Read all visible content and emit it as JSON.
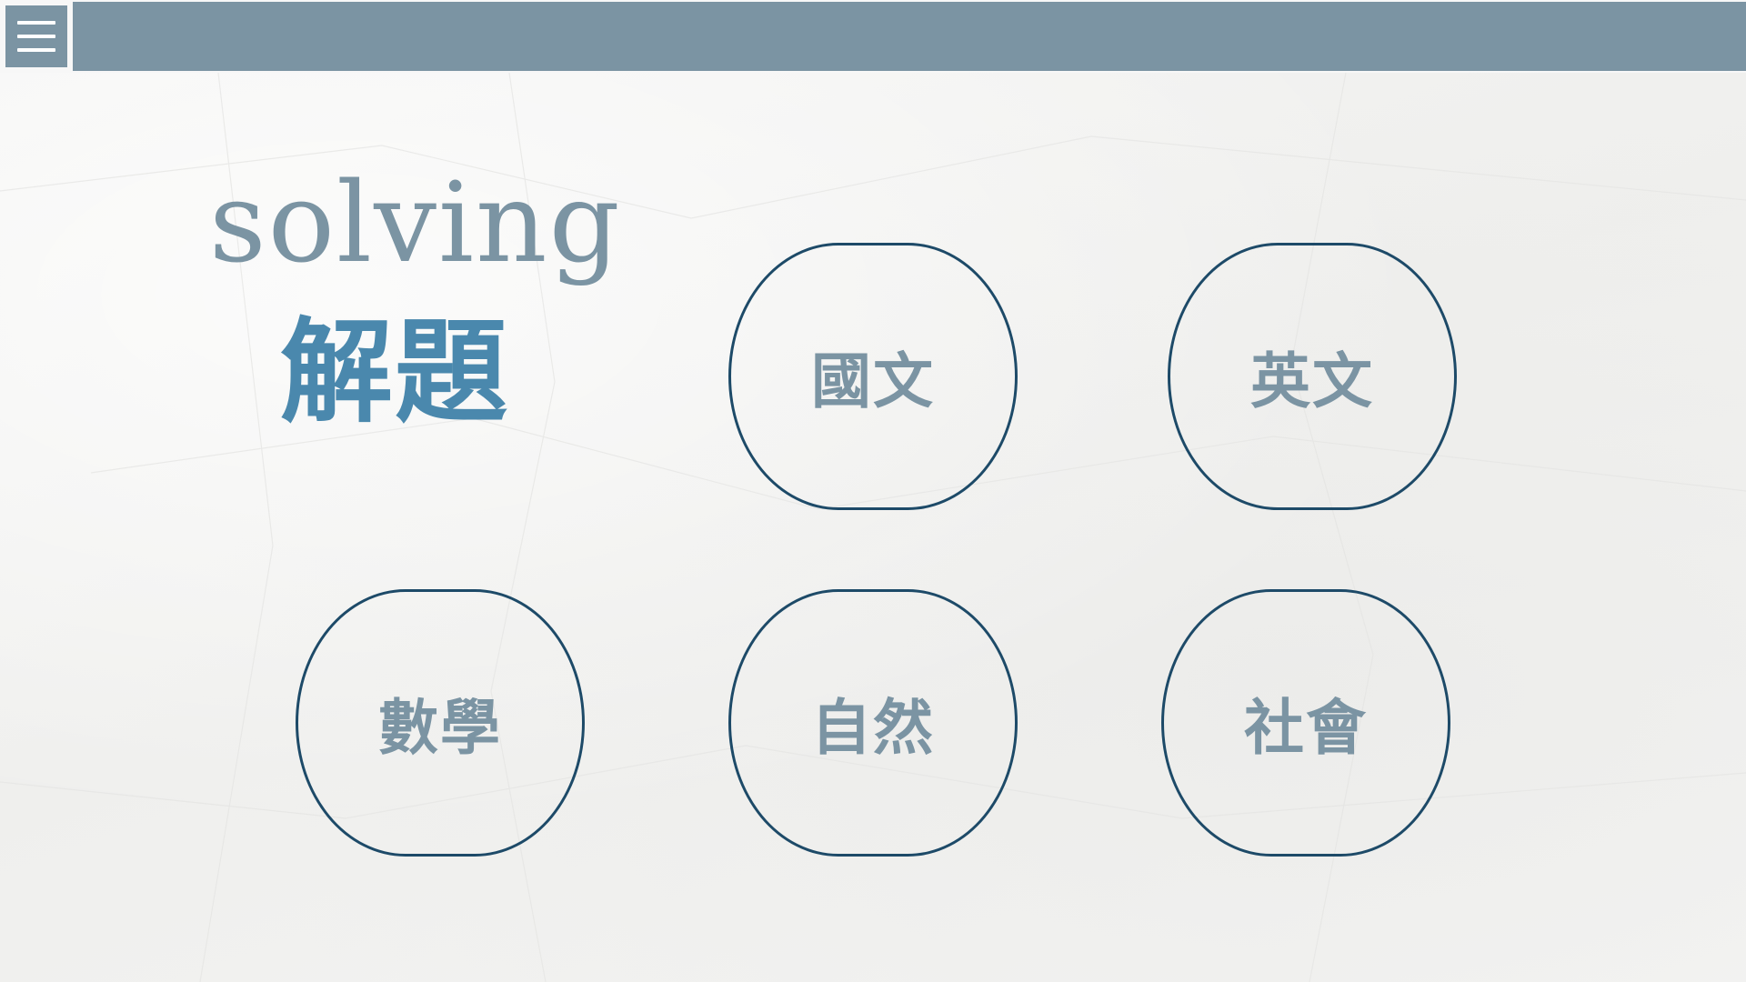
{
  "header": {
    "menu_icon": "hamburger-menu-icon"
  },
  "title": {
    "english": "solving",
    "chinese": "解題"
  },
  "subjects": [
    {
      "label": "國文"
    },
    {
      "label": "英文"
    },
    {
      "label": "數學"
    },
    {
      "label": "自然"
    },
    {
      "label": "社會"
    }
  ],
  "colors": {
    "header_bar": "#7b94a3",
    "title_english": "#7b94a3",
    "title_chinese": "#4a88ad",
    "button_border": "#1d4a68",
    "button_text": "#7b94a3",
    "background": "#f3f3f2"
  }
}
